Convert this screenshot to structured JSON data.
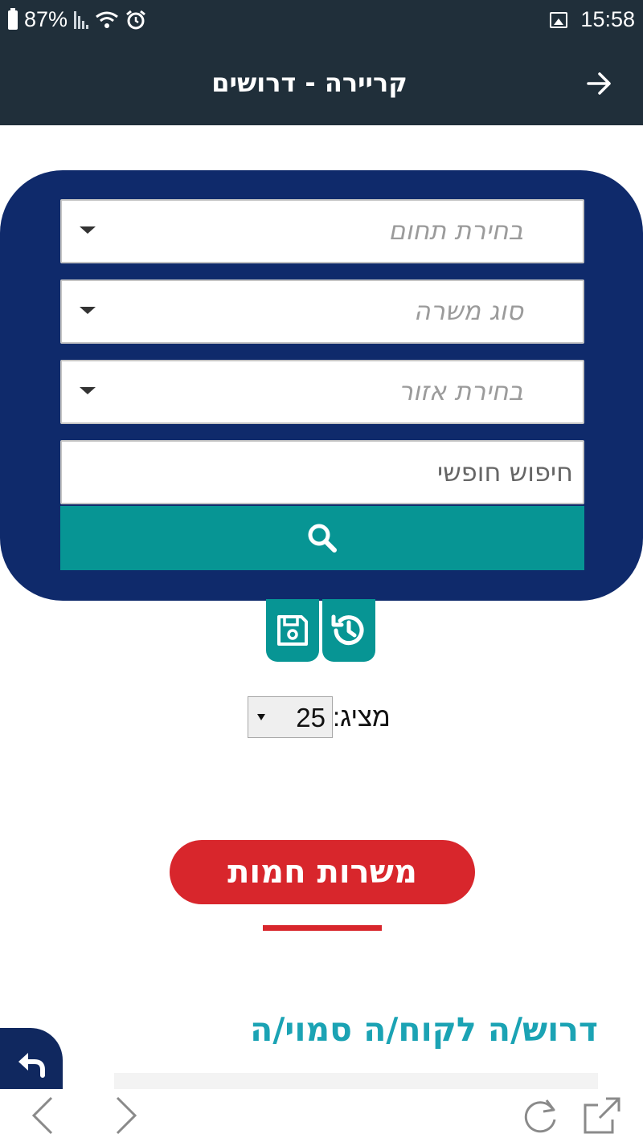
{
  "status_bar": {
    "battery": "87%",
    "time": "15:58"
  },
  "header": {
    "title": "קריירה - דרושים"
  },
  "search": {
    "field_placeholder": "בחירת תחום",
    "job_type_placeholder": "סוג משרה",
    "region_placeholder": "בחירת אזור",
    "free_search_placeholder": "חיפוש חופשי"
  },
  "listing": {
    "per_page_label": "מציג:",
    "per_page_value": "25"
  },
  "hot_jobs": {
    "label": "משרות חמות"
  },
  "job": {
    "title": "דרוש/ה לקוח/ה סמוי/ה"
  },
  "colors": {
    "header": "#202f3a",
    "panel": "#0f2a6b",
    "teal": "#079594",
    "hot": "#d8262c",
    "job_title": "#1ba3b4"
  }
}
